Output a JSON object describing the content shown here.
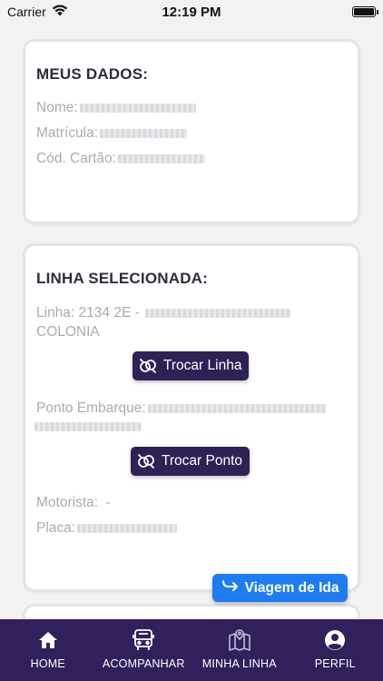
{
  "status_bar": {
    "carrier": "Carrier",
    "time": "12:19 PM",
    "battery_level": 1.0
  },
  "meus_dados": {
    "title": "MEUS DADOS:",
    "nome_label": "Nome:",
    "matricula_label": "Matrícula:",
    "cartao_label": "Cód. Cartão:"
  },
  "linha": {
    "title": "LINHA SELECIONADA:",
    "linha_label": "Linha: 2134 2E -",
    "linha_continuation": "COLONIA",
    "trocar_linha_label": "Trocar Linha",
    "ponto_label": "Ponto Embarque:",
    "trocar_ponto_label": "Trocar Ponto",
    "motorista_label": "Motorista:  -",
    "placa_label": "Placa:"
  },
  "fab": {
    "label": "Viagem de Ida"
  },
  "nav": {
    "items": [
      {
        "label": "HOME",
        "icon": "home-icon"
      },
      {
        "label": "ACOMPANHAR",
        "icon": "bus-icon"
      },
      {
        "label": "MINHA LINHA",
        "icon": "map-icon"
      },
      {
        "label": "PERFIL",
        "icon": "user-circle-icon"
      }
    ]
  },
  "colors": {
    "nav_bg": "#31205b",
    "button_bg": "#2f2155",
    "fab_bg": "#1e7cf2"
  }
}
